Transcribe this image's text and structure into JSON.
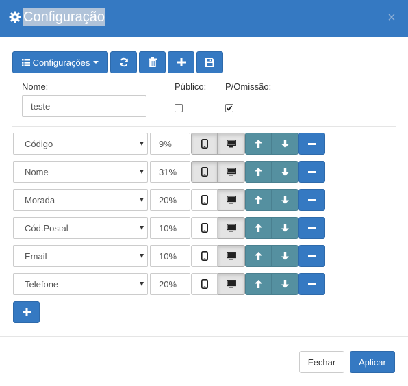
{
  "dialog": {
    "title": "Configuração",
    "close_icon": "×"
  },
  "toolbar": {
    "config_label": "Configurações",
    "icons": [
      "list-icon",
      "refresh-icon",
      "trash-icon",
      "plus-icon",
      "save-icon"
    ]
  },
  "form": {
    "name_label": "Nome:",
    "name_value": "teste",
    "public_label": "Público:",
    "public_checked": false,
    "default_label": "P/Omissão:",
    "default_checked": true
  },
  "columns": [
    {
      "field": "Código",
      "width": "9%",
      "mobile": true,
      "desktop": true
    },
    {
      "field": "Nome",
      "width": "31%",
      "mobile": true,
      "desktop": true
    },
    {
      "field": "Morada",
      "width": "20%",
      "mobile": false,
      "desktop": true
    },
    {
      "field": "Cód.Postal",
      "width": "10%",
      "mobile": false,
      "desktop": true
    },
    {
      "field": "Email",
      "width": "10%",
      "mobile": false,
      "desktop": true
    },
    {
      "field": "Telefone",
      "width": "20%",
      "mobile": false,
      "desktop": true
    }
  ],
  "footer": {
    "close_label": "Fechar",
    "apply_label": "Aplicar"
  },
  "colors": {
    "primary": "#3579c2",
    "teal": "#5590a0"
  }
}
